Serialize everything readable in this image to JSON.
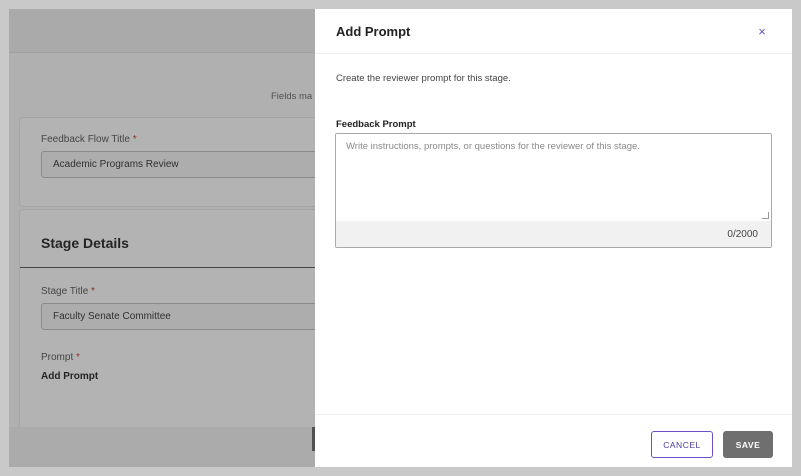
{
  "background": {
    "fields_note": "Fields ma",
    "flow_title_label": "Feedback Flow Title",
    "flow_title_value": "Academic Programs Review",
    "required_mark": "*",
    "stage_details_heading": "Stage Details",
    "stage_title_label": "Stage Title",
    "stage_title_value": "Faculty Senate Committee",
    "prompt_label": "Prompt",
    "add_prompt_link": "Add Prompt"
  },
  "modal": {
    "title": "Add Prompt",
    "close_icon": "close-icon",
    "close_glyph": "×",
    "description": "Create the reviewer prompt for this stage.",
    "field_label": "Feedback Prompt",
    "textarea_value": "",
    "textarea_placeholder": "Write instructions, prompts, or questions for the reviewer of this stage.",
    "char_counter": "0/2000",
    "cancel_label": "CANCEL",
    "save_label": "SAVE"
  },
  "colors": {
    "accent": "#6b4fc7",
    "save_button": "#6f6f6f",
    "required": "#c0392b"
  }
}
